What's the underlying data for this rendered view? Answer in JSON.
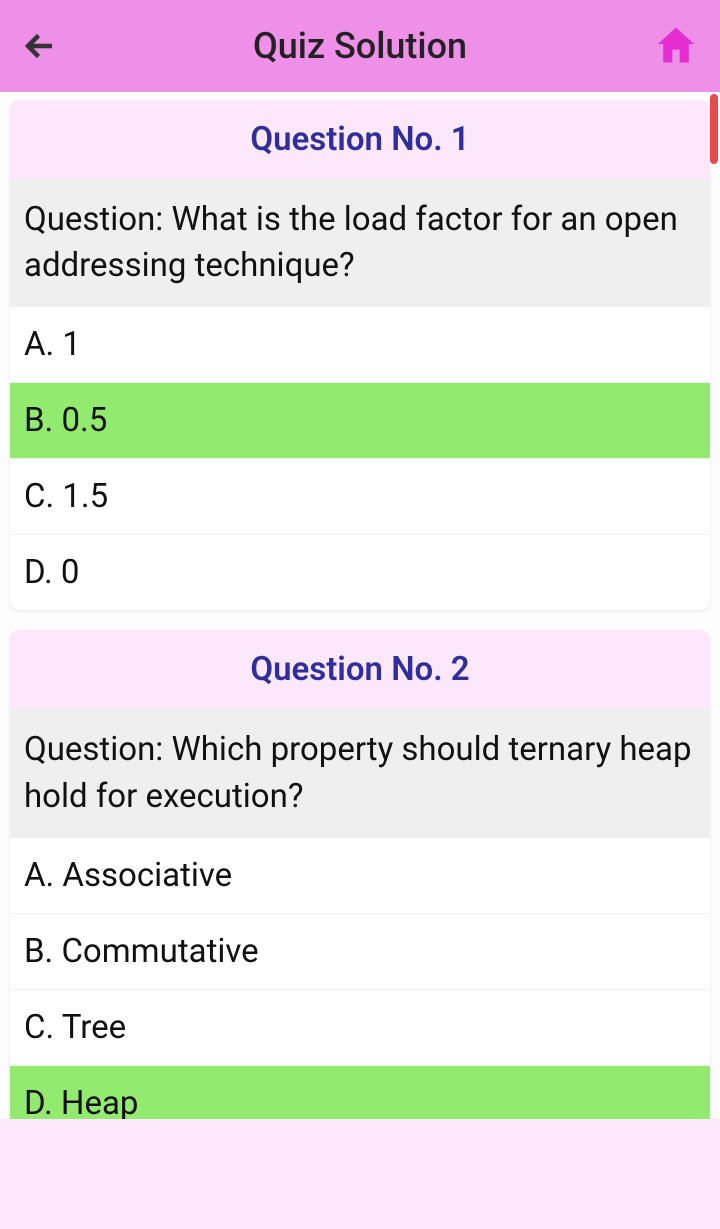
{
  "header": {
    "title": "Quiz Solution"
  },
  "questions": [
    {
      "label_prefix": "Question No.  ",
      "number": "1",
      "text": "Question: What is the load factor for an open addressing technique?",
      "options": [
        {
          "label": "A. 1",
          "correct": false
        },
        {
          "label": "B. 0.5",
          "correct": true
        },
        {
          "label": "C. 1.5",
          "correct": false
        },
        {
          "label": "D. 0",
          "correct": false
        }
      ]
    },
    {
      "label_prefix": "Question No.  ",
      "number": "2",
      "text": "Question: Which property should ternary heap hold for execution?",
      "options": [
        {
          "label": "A. Associative",
          "correct": false
        },
        {
          "label": "B. Commutative",
          "correct": false
        },
        {
          "label": "C. Tree",
          "correct": false
        },
        {
          "label": "D. Heap",
          "correct": true
        }
      ]
    }
  ]
}
